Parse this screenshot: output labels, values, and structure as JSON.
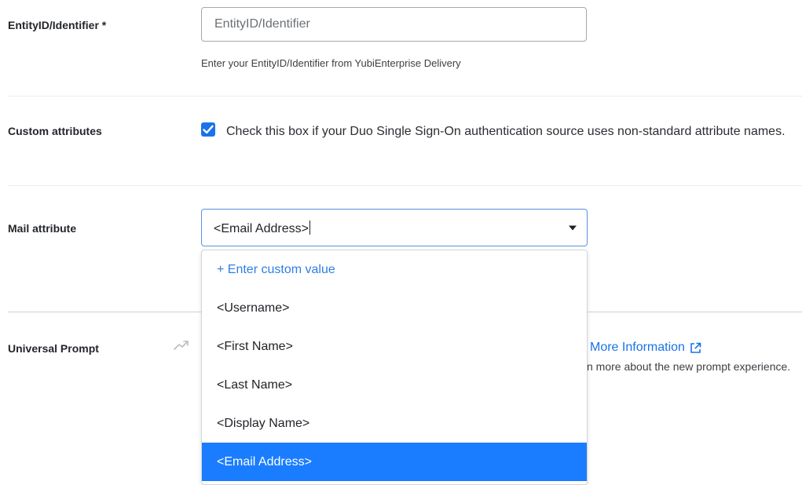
{
  "entity": {
    "label": "EntityID/Identifier *",
    "placeholder": "EntityID/Identifier",
    "help": "Enter your EntityID/Identifier from YubiEnterprise Delivery"
  },
  "custom_attributes": {
    "label": "Custom attributes",
    "checked": true,
    "text": "Check this box if your Duo Single Sign-On authentication source uses non-standard attribute names."
  },
  "mail_attribute": {
    "label": "Mail attribute",
    "value": "<Email Address>",
    "options": [
      "+ Enter custom value",
      "<Username>",
      "<First Name>",
      "<Last Name>",
      "<Display Name>",
      "<Email Address>"
    ]
  },
  "universal_prompt": {
    "label": "Universal Prompt",
    "more_info": "More Information",
    "learn_more_fragment": "n more about the new prompt experience."
  },
  "colors": {
    "accent": "#1a73e8",
    "selected_option": "#1a7dff",
    "link": "#2f7ee6"
  }
}
